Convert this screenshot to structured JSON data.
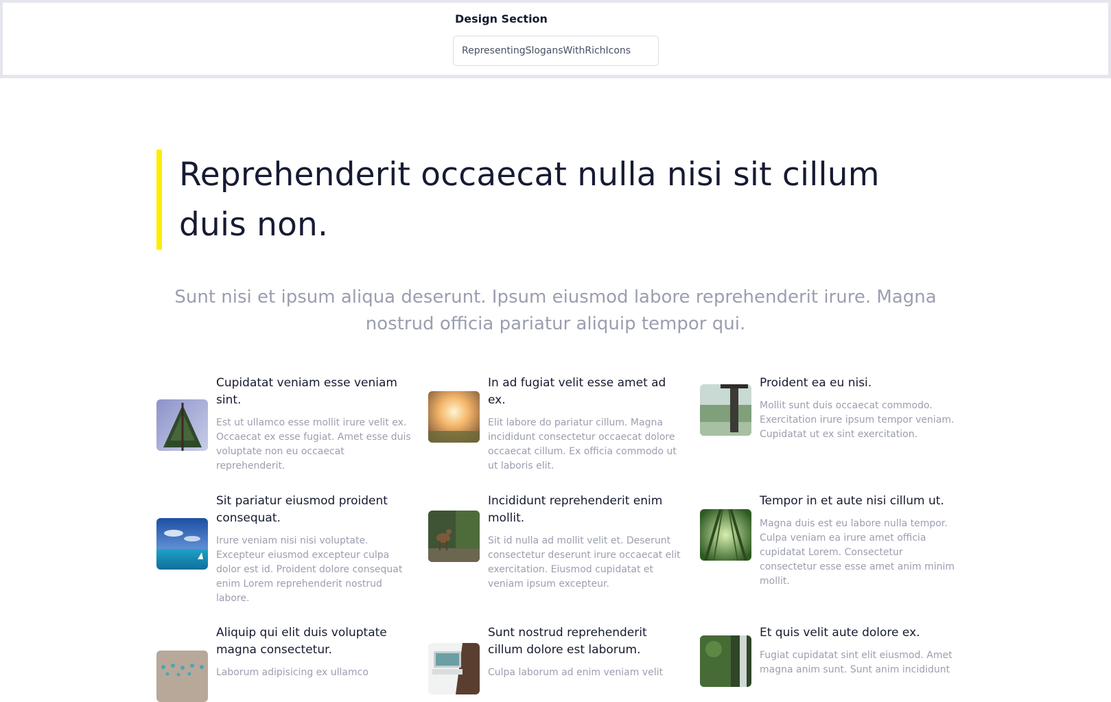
{
  "toolbar": {
    "section_label": "Design Section",
    "section_value": "RepresentingSlogansWithRichIcons"
  },
  "hero": {
    "title": "Reprehenderit occaecat nulla nisi sit cillum duis non.",
    "accent_color": "#fdee00"
  },
  "subtitle": "Sunt nisi et ipsum aliqua deserunt. Ipsum eiusmod labore reprehenderit irure. Magna nostrud officia pariatur aliquip tempor qui.",
  "features": [
    {
      "title": "Cupidatat veniam esse veniam sint.",
      "desc": "Est ut ullamco esse mollit irure velit ex. Occaecat ex esse fugiat. Amet esse duis voluptate non eu occaecat reprehenderit.",
      "image": "tree-branch-photo"
    },
    {
      "title": "In ad fugiat velit esse amet ad ex.",
      "desc": "Elit labore do pariatur cillum. Magna incididunt consectetur occaecat dolore occaecat cillum. Ex officia commodo ut ut laboris elit.",
      "image": "sunlight-field-photo"
    },
    {
      "title": "Proident ea eu nisi.",
      "desc": "Mollit sunt duis occaecat commodo. Exercitation irure ipsum tempor veniam. Cupidatat ut ex sint exercitation.",
      "image": "pier-post-lake-photo"
    },
    {
      "title": "Sit pariatur eiusmod proident consequat.",
      "desc": "Irure veniam nisi nisi voluptate. Excepteur eiusmod excepteur culpa dolor est id. Proident dolore consequat enim Lorem reprehenderit nostrud labore.",
      "image": "ocean-sky-photo"
    },
    {
      "title": "Incididunt reprehenderit enim mollit.",
      "desc": "Sit id nulla ad mollit velit et. Deserunt consectetur deserunt irure occaecat elit exercitation. Eiusmod cupidatat et veniam ipsum excepteur.",
      "image": "deer-forest-photo"
    },
    {
      "title": "Tempor in et aute nisi cillum ut.",
      "desc": "Magna duis est eu labore nulla tempor. Culpa veniam ea irure amet officia cupidatat Lorem. Consectetur consectetur esse esse amet anim minim mollit.",
      "image": "bamboo-forest-photo"
    },
    {
      "title": "Aliquip qui elit duis voluptate magna consectetur.",
      "desc": "Laborum adipisicing ex ullamco",
      "image": "water-drops-photo"
    },
    {
      "title": "Sunt nostrud reprehenderit cillum dolore est laborum.",
      "desc": "Culpa laborum ad enim veniam velit",
      "image": "laptop-desk-photo"
    },
    {
      "title": "Et quis velit aute dolore ex.",
      "desc": "Fugiat cupidatat sint elit eiusmod. Amet magna anim sunt. Sunt anim incididunt",
      "image": "waterfall-forest-photo"
    }
  ]
}
